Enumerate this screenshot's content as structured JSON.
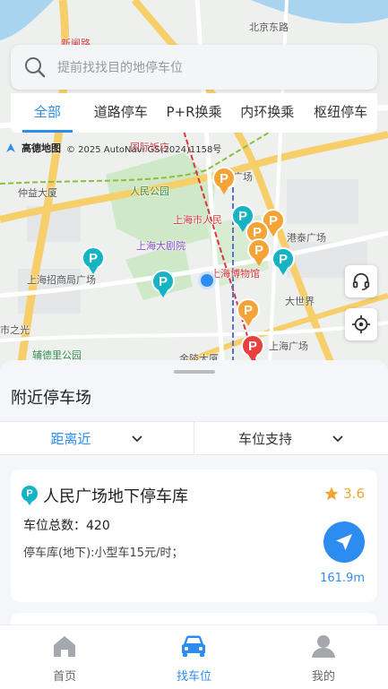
{
  "map": {
    "labels": {
      "road_beijing_east": "北京东路",
      "metro_xinzha": "新闸路",
      "zhongyi": "仲益大厦",
      "peoples_park": "人民公园",
      "shanghai_city_people": "上海市人民",
      "grand_theatre": "上海大剧院",
      "zhaoshang": "上海招商局广场",
      "museum": "上海博物馆",
      "gangtai": "港泰广场",
      "great_world": "大世界",
      "zhiguang": "市之光",
      "fudeli_park": "辅德里公园",
      "jindu": "金陵大厦",
      "sh_square": "上海广场",
      "renmin_square": "人民广场",
      "guoji_hotel": "国际饭店"
    },
    "attribution": "© 2025 AutoNavi GS(2024)1158号",
    "logo_text": "高德地图",
    "user_location_icon": "location-dot-icon",
    "support_icon": "headset-icon",
    "locate_icon": "crosshair-icon"
  },
  "search": {
    "placeholder": "提前找找目的地停车位",
    "icon": "search-icon"
  },
  "tabs": [
    {
      "label": "全部",
      "active": true
    },
    {
      "label": "道路停车",
      "active": false
    },
    {
      "label": "P+R换乘",
      "active": false
    },
    {
      "label": "内环换乘",
      "active": false
    },
    {
      "label": "枢纽停车",
      "active": false
    }
  ],
  "pin_letter": "P",
  "sheet": {
    "title": "附近停车场",
    "filters": [
      {
        "label": "距离近",
        "active": true
      },
      {
        "label": "车位支持",
        "active": false
      }
    ],
    "lots": [
      {
        "name": "人民广场地下停车库",
        "rating": "3.6",
        "total": "车位总数：420",
        "price": "停车库(地下):小型车15元/时；",
        "distance": "161.9m"
      }
    ]
  },
  "tabbar": [
    {
      "label": "首页",
      "icon": "home-icon",
      "active": false
    },
    {
      "label": "找车位",
      "icon": "car-icon",
      "active": true
    },
    {
      "label": "我的",
      "icon": "user-icon",
      "active": false
    }
  ],
  "colors": {
    "accent": "#2d8cf0",
    "pin_teal": "#15b3c4",
    "pin_orange": "#f4a337",
    "pin_red": "#e8403e",
    "rating_star": "#f4a337"
  }
}
